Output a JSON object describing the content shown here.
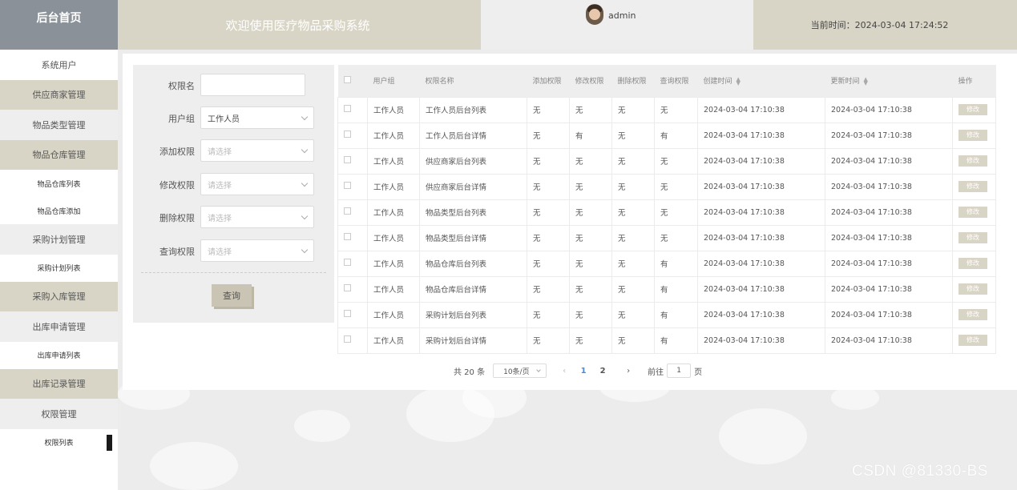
{
  "header": {
    "brand": "后台首页",
    "welcome": "欢迎使用医疗物品采购系统",
    "username": "admin",
    "time_label": "当前时间：2024-03-04 17:24:52"
  },
  "sidebar": {
    "items": [
      {
        "label": "系统用户",
        "type": "menu",
        "style": "white"
      },
      {
        "label": "供应商家管理",
        "type": "menu",
        "style": "tan"
      },
      {
        "label": "物品类型管理",
        "type": "menu",
        "style": "grey"
      },
      {
        "label": "物品仓库管理",
        "type": "menu",
        "style": "tan"
      },
      {
        "label": "物品仓库列表",
        "type": "sub"
      },
      {
        "label": "物品仓库添加",
        "type": "sub"
      },
      {
        "label": "采购计划管理",
        "type": "menu",
        "style": "grey"
      },
      {
        "label": "采购计划列表",
        "type": "sub"
      },
      {
        "label": "采购入库管理",
        "type": "menu",
        "style": "tan"
      },
      {
        "label": "出库申请管理",
        "type": "menu",
        "style": "grey"
      },
      {
        "label": "出库申请列表",
        "type": "sub"
      },
      {
        "label": "出库记录管理",
        "type": "menu",
        "style": "tan"
      },
      {
        "label": "权限管理",
        "type": "menu",
        "style": "grey"
      },
      {
        "label": "权限列表",
        "type": "sub",
        "active": true
      }
    ]
  },
  "search": {
    "fields": [
      {
        "label": "权限名",
        "value": "",
        "kind": "input"
      },
      {
        "label": "用户组",
        "value": "工作人员",
        "kind": "select"
      },
      {
        "label": "添加权限",
        "value": "请选择",
        "kind": "select",
        "placeholder": true
      },
      {
        "label": "修改权限",
        "value": "请选择",
        "kind": "select",
        "placeholder": true
      },
      {
        "label": "删除权限",
        "value": "请选择",
        "kind": "select",
        "placeholder": true
      },
      {
        "label": "查询权限",
        "value": "请选择",
        "kind": "select",
        "placeholder": true
      }
    ],
    "query_label": "查询"
  },
  "table": {
    "columns": [
      "用户组",
      "权限名称",
      "添加权限",
      "修改权限",
      "删除权限",
      "查询权限",
      "创建时间",
      "更新时间",
      "操作"
    ],
    "edit_label": "修改",
    "rows": [
      [
        "工作人员",
        "工作人员后台列表",
        "无",
        "无",
        "无",
        "无",
        "2024-03-04 17:10:38",
        "2024-03-04 17:10:38"
      ],
      [
        "工作人员",
        "工作人员后台详情",
        "无",
        "有",
        "无",
        "有",
        "2024-03-04 17:10:38",
        "2024-03-04 17:10:38"
      ],
      [
        "工作人员",
        "供应商家后台列表",
        "无",
        "无",
        "无",
        "无",
        "2024-03-04 17:10:38",
        "2024-03-04 17:10:38"
      ],
      [
        "工作人员",
        "供应商家后台详情",
        "无",
        "无",
        "无",
        "无",
        "2024-03-04 17:10:38",
        "2024-03-04 17:10:38"
      ],
      [
        "工作人员",
        "物品类型后台列表",
        "无",
        "无",
        "无",
        "无",
        "2024-03-04 17:10:38",
        "2024-03-04 17:10:38"
      ],
      [
        "工作人员",
        "物品类型后台详情",
        "无",
        "无",
        "无",
        "无",
        "2024-03-04 17:10:38",
        "2024-03-04 17:10:38"
      ],
      [
        "工作人员",
        "物品仓库后台列表",
        "无",
        "无",
        "无",
        "有",
        "2024-03-04 17:10:38",
        "2024-03-04 17:10:38"
      ],
      [
        "工作人员",
        "物品仓库后台详情",
        "无",
        "无",
        "无",
        "有",
        "2024-03-04 17:10:38",
        "2024-03-04 17:10:38"
      ],
      [
        "工作人员",
        "采购计划后台列表",
        "无",
        "无",
        "无",
        "有",
        "2024-03-04 17:10:38",
        "2024-03-04 17:10:38"
      ],
      [
        "工作人员",
        "采购计划后台详情",
        "无",
        "无",
        "无",
        "有",
        "2024-03-04 17:10:38",
        "2024-03-04 17:10:38"
      ]
    ]
  },
  "pagination": {
    "total": "共 20 条",
    "page_size": "10条/页",
    "pages": [
      "1",
      "2"
    ],
    "current": "1",
    "goto_label": "前往",
    "goto_value": "1",
    "page_suffix": "页"
  },
  "watermark": "CSDN @81330-BS",
  "colors": {
    "brand_bg": "#8a9199",
    "tan": "#d9d5c6",
    "grey": "#eeeeee",
    "active_page": "#4a8bd8"
  }
}
